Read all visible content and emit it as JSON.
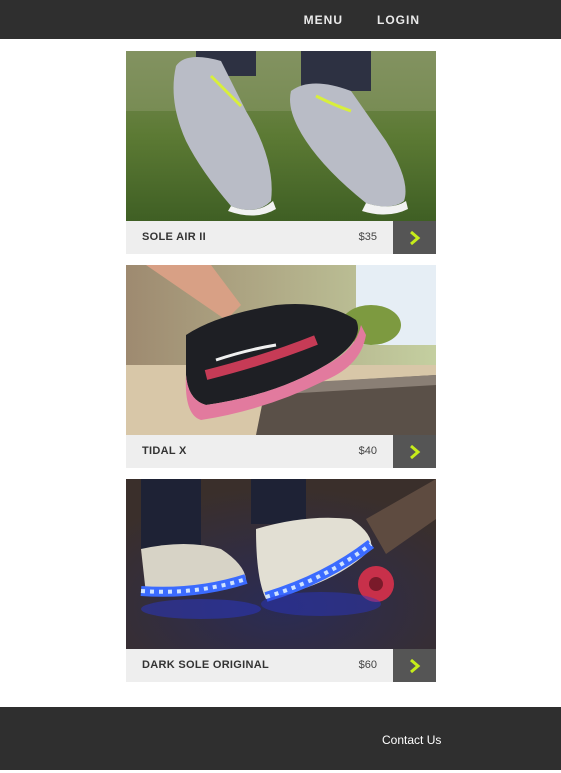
{
  "nav": {
    "menu_label": "MENU",
    "login_label": "LOGIN"
  },
  "products": [
    {
      "name": "SOLE AIR II",
      "price": "$35",
      "icon": "chevron-right-icon"
    },
    {
      "name": "TIDAL X",
      "price": "$40",
      "icon": "chevron-right-icon"
    },
    {
      "name": "DARK SOLE ORIGINAL",
      "price": "$60",
      "icon": "chevron-right-icon"
    }
  ],
  "footer": {
    "contact_label": "Contact Us"
  },
  "colors": {
    "header_bg": "#2f2f2f",
    "card_bar_bg": "#eeeeee",
    "button_bg": "#555555",
    "accent": "#c6ec1a",
    "footer_bg": "#2f2f2f"
  }
}
